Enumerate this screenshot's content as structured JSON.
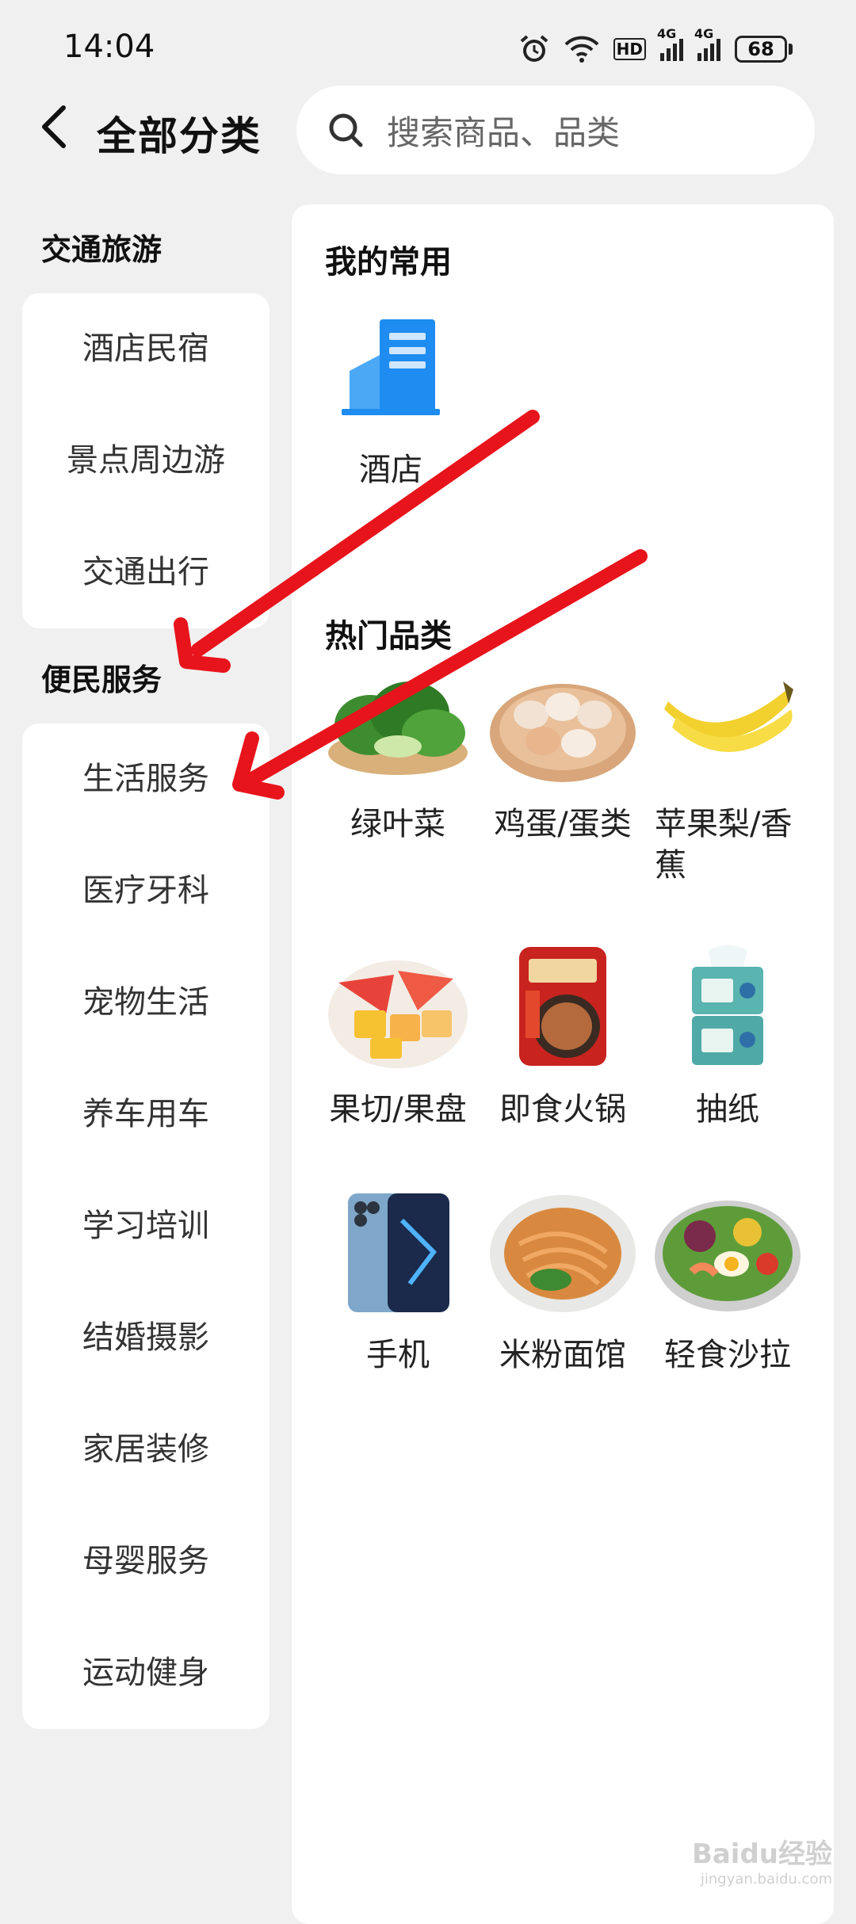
{
  "status": {
    "time": "14:04",
    "battery": "68",
    "hd": "HD",
    "net1": "4G",
    "net2": "4G"
  },
  "header": {
    "title": "全部分类",
    "search_placeholder": "搜索商品、品类"
  },
  "sidebar": {
    "groups": [
      {
        "title": "交通旅游",
        "items": [
          "酒店民宿",
          "景点周边游",
          "交通出行"
        ]
      },
      {
        "title": "便民服务",
        "items": [
          "生活服务",
          "医疗牙科",
          "宠物生活",
          "养车用车",
          "学习培训",
          "结婚摄影",
          "家居装修",
          "母婴服务",
          "运动健身"
        ]
      }
    ]
  },
  "main": {
    "favorites_title": "我的常用",
    "favorites": [
      {
        "label": "酒店",
        "icon": "hotel-building-icon"
      }
    ],
    "hot_title": "热门品类",
    "hot_categories": [
      {
        "label": "绿叶菜",
        "icon": "leafy-greens-icon"
      },
      {
        "label": "鸡蛋/蛋类",
        "icon": "eggs-icon"
      },
      {
        "label": "苹果梨/香蕉",
        "icon": "banana-icon"
      },
      {
        "label": "果切/果盘",
        "icon": "fruit-platter-icon"
      },
      {
        "label": "即食火锅",
        "icon": "instant-hotpot-icon"
      },
      {
        "label": "抽纸",
        "icon": "tissue-icon"
      },
      {
        "label": "手机",
        "icon": "phone-icon"
      },
      {
        "label": "米粉面馆",
        "icon": "noodles-icon"
      },
      {
        "label": "轻食沙拉",
        "icon": "salad-icon"
      }
    ]
  },
  "watermark": {
    "main": "Baidu经验",
    "sub": "jingyan.baidu.com"
  },
  "colors": {
    "background": "#f0f0f0",
    "card": "#ffffff",
    "annotation_arrow": "#e8141b",
    "hotel_icon": "#1e8cf0"
  }
}
